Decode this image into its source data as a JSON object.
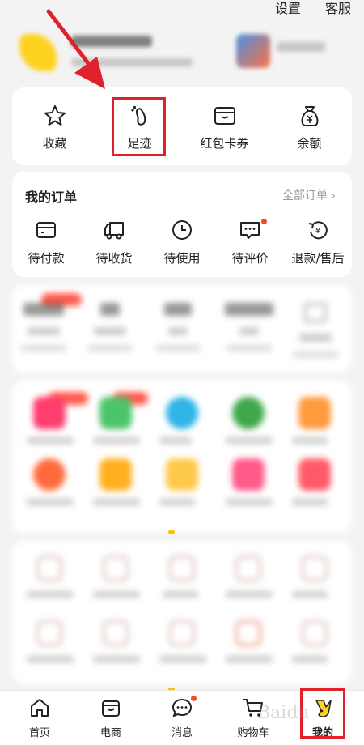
{
  "top_links": {
    "settings": "设置",
    "service": "客服"
  },
  "quick_actions": [
    {
      "label": "收藏",
      "icon": "star-icon"
    },
    {
      "label": "足迹",
      "icon": "footprint-icon"
    },
    {
      "label": "红包卡券",
      "icon": "wallet-icon"
    },
    {
      "label": "余额",
      "icon": "money-bag-icon"
    }
  ],
  "orders": {
    "title": "我的订单",
    "all_link": "全部订单 ›",
    "items": [
      {
        "label": "待付款",
        "icon": "card-icon"
      },
      {
        "label": "待收货",
        "icon": "truck-icon"
      },
      {
        "label": "待使用",
        "icon": "clock-icon"
      },
      {
        "label": "待评价",
        "icon": "comment-icon"
      },
      {
        "label": "退款/售后",
        "icon": "refund-icon"
      }
    ]
  },
  "tabbar": [
    {
      "label": "首页",
      "icon": "home-icon"
    },
    {
      "label": "电商",
      "icon": "shop-bag-icon"
    },
    {
      "label": "消息",
      "icon": "message-icon"
    },
    {
      "label": "购物车",
      "icon": "cart-icon"
    },
    {
      "label": "我的",
      "icon": "mine-icon"
    }
  ],
  "watermark": "Baidu",
  "colors": {
    "highlight": "#e0202a",
    "accent": "#ffd21f",
    "dot": "#f04a2a"
  }
}
